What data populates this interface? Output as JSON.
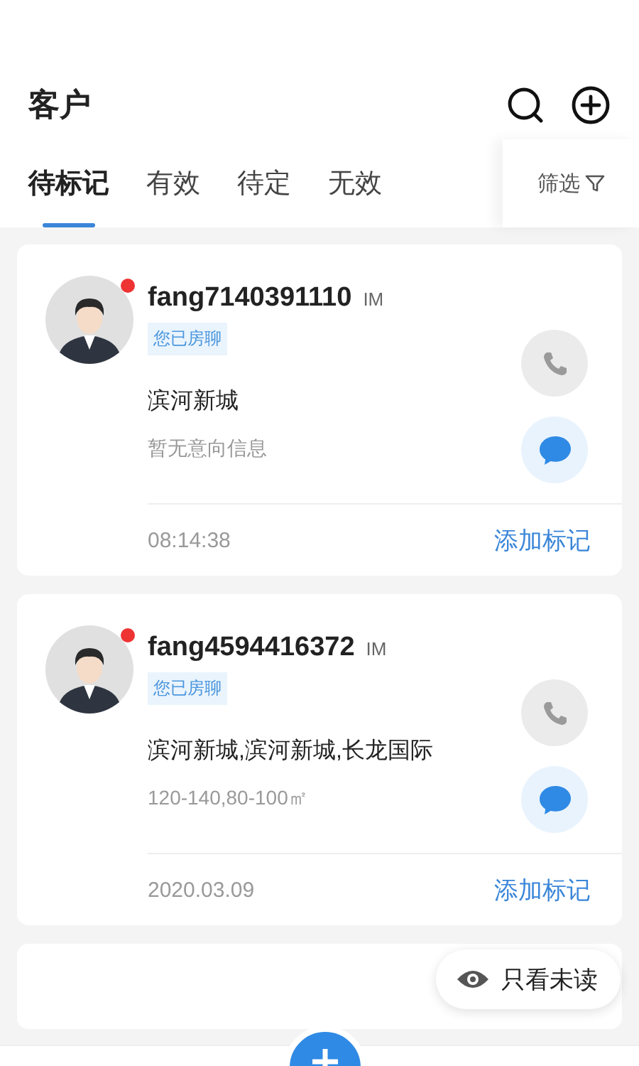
{
  "header": {
    "title": "客户"
  },
  "tabs": [
    {
      "label": "待标记",
      "selected": true
    },
    {
      "label": "有效",
      "selected": false
    },
    {
      "label": "待定",
      "selected": false
    },
    {
      "label": "无效",
      "selected": false
    }
  ],
  "filter": {
    "label": "筛选"
  },
  "customers": [
    {
      "name": "fang7140391110",
      "source": "IM",
      "unread": true,
      "tag": "您已房聊",
      "area": "滨河新城",
      "intent": "暂无意向信息",
      "time": "08:14:38",
      "action": "添加标记"
    },
    {
      "name": "fang4594416372",
      "source": "IM",
      "unread": true,
      "tag": "您已房聊",
      "area": "滨河新城,滨河新城,长龙国际",
      "intent": "120-140,80-100㎡",
      "time": "2020.03.09",
      "action": "添加标记"
    }
  ],
  "unread_filter": {
    "label": "只看未读"
  }
}
